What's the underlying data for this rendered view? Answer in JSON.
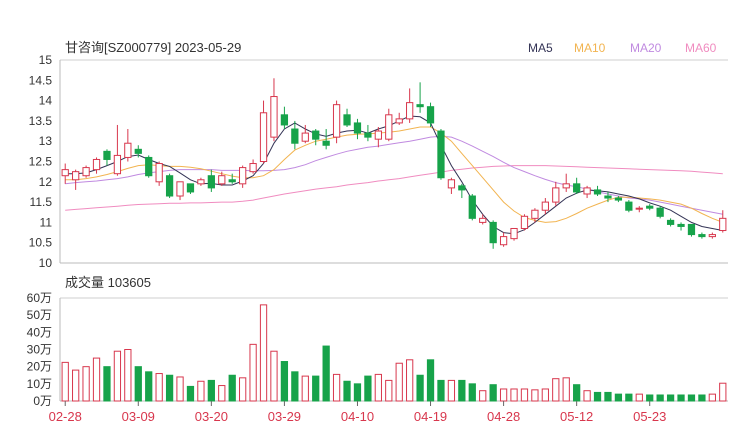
{
  "chart_data": [
    {
      "type": "candlestick",
      "title": "甘咨询[SZ000779] 2023-05-29",
      "legend": [
        {
          "name": "MA5",
          "color": "#333355"
        },
        {
          "name": "MA10",
          "color": "#f2b450"
        },
        {
          "name": "MA20",
          "color": "#c08ae0"
        },
        {
          "name": "MA60",
          "color": "#f08cc0"
        }
      ],
      "ylim": [
        10,
        15
      ],
      "yticks": [
        "15",
        "14.5",
        "14",
        "13.5",
        "13",
        "12.5",
        "12",
        "11.5",
        "11",
        "10.5",
        "10"
      ],
      "x_tick_labels": [
        "02-28",
        "03-09",
        "03-20",
        "03-29",
        "04-10",
        "04-19",
        "04-28",
        "05-12",
        "05-23"
      ],
      "x_tick_index": [
        0,
        7,
        14,
        21,
        28,
        35,
        42,
        49,
        56
      ],
      "up_color": "#d8374d",
      "down_color": "#17a34a",
      "candles": [
        [
          12.15,
          12.3,
          12.45,
          11.95
        ],
        [
          12.05,
          12.25,
          12.3,
          11.8
        ],
        [
          12.15,
          12.35,
          12.4,
          12.1
        ],
        [
          12.3,
          12.55,
          12.6,
          12.2
        ],
        [
          12.75,
          12.55,
          12.8,
          12.4
        ],
        [
          12.2,
          12.65,
          13.4,
          12.15
        ],
        [
          12.6,
          12.95,
          13.3,
          12.5
        ],
        [
          12.8,
          12.7,
          12.9,
          12.6
        ],
        [
          12.6,
          12.15,
          12.65,
          12.1
        ],
        [
          12.0,
          12.45,
          12.5,
          11.9
        ],
        [
          12.15,
          11.65,
          12.2,
          11.6
        ],
        [
          11.65,
          12.0,
          12.0,
          11.55
        ],
        [
          11.95,
          11.75,
          11.95,
          11.7
        ],
        [
          11.95,
          12.05,
          12.1,
          11.9
        ],
        [
          12.15,
          11.85,
          12.3,
          11.75
        ],
        [
          11.95,
          12.15,
          12.25,
          11.9
        ],
        [
          12.05,
          12.0,
          12.2,
          11.95
        ],
        [
          11.95,
          12.35,
          12.4,
          11.85
        ],
        [
          12.25,
          12.45,
          12.55,
          12.2
        ],
        [
          12.5,
          13.7,
          14.0,
          12.45
        ],
        [
          13.1,
          14.1,
          14.55,
          13.0
        ],
        [
          13.65,
          13.4,
          13.85,
          13.3
        ],
        [
          13.3,
          12.95,
          13.5,
          12.8
        ],
        [
          13.0,
          13.2,
          13.4,
          12.95
        ],
        [
          13.25,
          13.05,
          13.3,
          12.9
        ],
        [
          13.0,
          12.9,
          13.3,
          12.8
        ],
        [
          13.1,
          13.9,
          14.0,
          12.95
        ],
        [
          13.65,
          13.4,
          13.8,
          13.35
        ],
        [
          13.45,
          13.2,
          13.55,
          13.05
        ],
        [
          13.2,
          13.1,
          13.4,
          13.0
        ],
        [
          13.05,
          13.25,
          13.35,
          12.85
        ],
        [
          13.05,
          13.65,
          13.8,
          13.0
        ],
        [
          13.45,
          13.55,
          13.7,
          13.4
        ],
        [
          13.55,
          13.95,
          14.3,
          13.45
        ],
        [
          13.9,
          13.85,
          14.45,
          13.7
        ],
        [
          13.85,
          13.45,
          13.95,
          13.35
        ],
        [
          13.25,
          12.1,
          13.3,
          12.05
        ],
        [
          11.85,
          12.05,
          12.1,
          11.7
        ],
        [
          11.9,
          11.8,
          11.95,
          11.6
        ],
        [
          11.65,
          11.1,
          11.7,
          11.05
        ],
        [
          11.0,
          11.1,
          11.2,
          10.95
        ],
        [
          11.0,
          10.5,
          11.05,
          10.35
        ],
        [
          10.45,
          10.65,
          10.75,
          10.4
        ],
        [
          10.6,
          10.85,
          10.85,
          10.55
        ],
        [
          10.85,
          11.15,
          11.2,
          10.8
        ],
        [
          11.1,
          11.3,
          11.35,
          11.0
        ],
        [
          11.3,
          11.5,
          11.6,
          11.2
        ],
        [
          11.5,
          11.85,
          12.0,
          11.4
        ],
        [
          11.85,
          11.95,
          12.2,
          11.75
        ],
        [
          11.95,
          11.75,
          12.1,
          11.7
        ],
        [
          11.7,
          11.85,
          11.9,
          11.6
        ],
        [
          11.8,
          11.7,
          11.9,
          11.65
        ],
        [
          11.65,
          11.6,
          11.75,
          11.5
        ],
        [
          11.6,
          11.55,
          11.65,
          11.5
        ],
        [
          11.5,
          11.3,
          11.55,
          11.25
        ],
        [
          11.35,
          11.35,
          11.4,
          11.25
        ],
        [
          11.4,
          11.35,
          11.45,
          11.3
        ],
        [
          11.35,
          11.15,
          11.4,
          11.1
        ],
        [
          11.05,
          10.95,
          11.1,
          10.9
        ],
        [
          10.95,
          10.9,
          11.0,
          10.8
        ],
        [
          10.95,
          10.7,
          10.95,
          10.65
        ],
        [
          10.7,
          10.65,
          10.75,
          10.6
        ],
        [
          10.65,
          10.7,
          10.75,
          10.6
        ],
        [
          10.8,
          11.1,
          11.3,
          10.75
        ]
      ],
      "ma5": [
        12.2,
        12.2,
        12.22,
        12.3,
        12.4,
        12.5,
        12.62,
        12.66,
        12.55,
        12.45,
        12.38,
        12.22,
        12.05,
        11.95,
        11.96,
        11.92,
        11.92,
        12.02,
        12.15,
        12.45,
        12.95,
        13.3,
        13.45,
        13.3,
        13.18,
        13.12,
        13.2,
        13.25,
        13.27,
        13.2,
        13.3,
        13.38,
        13.5,
        13.62,
        13.6,
        13.45,
        12.9,
        12.4,
        12.0,
        11.55,
        11.2,
        10.9,
        10.75,
        10.72,
        10.82,
        11.0,
        11.2,
        11.4,
        11.6,
        11.72,
        11.8,
        11.78,
        11.75,
        11.7,
        11.65,
        11.58,
        11.48,
        11.4,
        11.3,
        11.15,
        11.0,
        10.9,
        10.85,
        10.8
      ],
      "ma10": [
        12.05,
        12.05,
        12.08,
        12.12,
        12.18,
        12.25,
        12.33,
        12.4,
        12.42,
        12.4,
        12.38,
        12.38,
        12.36,
        12.32,
        12.26,
        12.2,
        12.14,
        12.1,
        12.1,
        12.15,
        12.3,
        12.55,
        12.78,
        12.9,
        13.0,
        13.05,
        13.1,
        13.15,
        13.17,
        13.18,
        13.2,
        13.22,
        13.25,
        13.3,
        13.35,
        13.35,
        13.2,
        13.0,
        12.7,
        12.4,
        12.1,
        11.8,
        11.5,
        11.28,
        11.12,
        11.05,
        11.0,
        11.02,
        11.1,
        11.22,
        11.35,
        11.45,
        11.55,
        11.62,
        11.62,
        11.6,
        11.58,
        11.55,
        11.5,
        11.45,
        11.35,
        11.22,
        11.1,
        11.0
      ],
      "ma20": [
        11.95,
        11.98,
        12.0,
        12.02,
        12.05,
        12.08,
        12.12,
        12.18,
        12.22,
        12.25,
        12.28,
        12.3,
        12.3,
        12.3,
        12.3,
        12.28,
        12.28,
        12.28,
        12.27,
        12.27,
        12.28,
        12.3,
        12.35,
        12.42,
        12.52,
        12.6,
        12.68,
        12.75,
        12.8,
        12.85,
        12.88,
        12.92,
        12.96,
        13.0,
        13.05,
        13.1,
        13.12,
        13.1,
        13.0,
        12.88,
        12.75,
        12.62,
        12.48,
        12.35,
        12.25,
        12.15,
        12.06,
        11.98,
        11.92,
        11.88,
        11.82,
        11.75,
        11.7,
        11.65,
        11.6,
        11.58,
        11.55,
        11.5,
        11.45,
        11.4,
        11.35,
        11.3,
        11.25,
        11.2
      ],
      "ma60": [
        11.3,
        11.32,
        11.34,
        11.36,
        11.38,
        11.4,
        11.42,
        11.44,
        11.45,
        11.46,
        11.47,
        11.47,
        11.48,
        11.48,
        11.49,
        11.5,
        11.5,
        11.52,
        11.55,
        11.6,
        11.65,
        11.7,
        11.74,
        11.78,
        11.82,
        11.85,
        11.88,
        11.92,
        11.95,
        11.98,
        12.02,
        12.05,
        12.08,
        12.12,
        12.16,
        12.2,
        12.24,
        12.28,
        12.31,
        12.34,
        12.36,
        12.38,
        12.39,
        12.4,
        12.4,
        12.4,
        12.4,
        12.39,
        12.38,
        12.37,
        12.36,
        12.35,
        12.34,
        12.33,
        12.32,
        12.31,
        12.3,
        12.29,
        12.28,
        12.27,
        12.26,
        12.24,
        12.22,
        12.2
      ]
    },
    {
      "type": "bar",
      "title": "成交量 103605",
      "ylim": [
        0,
        600000
      ],
      "yticks": [
        "60万",
        "50万",
        "40万",
        "30万",
        "20万",
        "10万",
        "0万"
      ],
      "volumes": [
        225000,
        180000,
        200000,
        250000,
        200000,
        290000,
        300000,
        200000,
        170000,
        160000,
        150000,
        140000,
        85000,
        115000,
        120000,
        90000,
        150000,
        135000,
        330000,
        560000,
        290000,
        230000,
        170000,
        145000,
        145000,
        320000,
        155000,
        115000,
        100000,
        145000,
        155000,
        120000,
        220000,
        240000,
        150000,
        240000,
        120000,
        120000,
        120000,
        100000,
        60000,
        95000,
        70000,
        70000,
        70000,
        65000,
        70000,
        130000,
        135000,
        95000,
        60000,
        50000,
        50000,
        40000,
        40000,
        40000,
        35000,
        35000,
        35000,
        35000,
        35000,
        35000,
        40000,
        103605
      ]
    }
  ]
}
